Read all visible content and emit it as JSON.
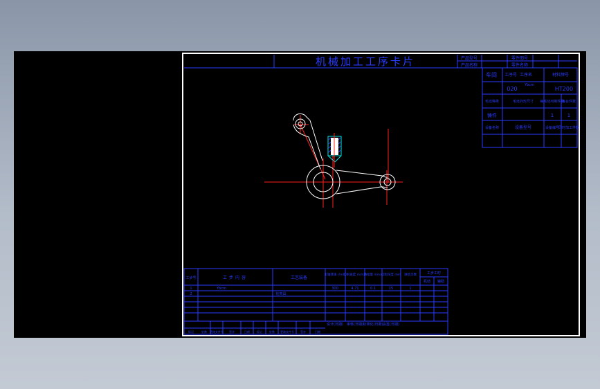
{
  "drawing": {
    "title": "机械加工工序卡片",
    "header_small": [
      "产品型号",
      "产品名称",
      "零件图号",
      "零件名称"
    ],
    "workshop_label": "车间",
    "col_headers": [
      "工序号",
      "工序名",
      "材料牌号"
    ],
    "process_no": "020",
    "process_name": "Ybcm",
    "material": "HT200",
    "blank_headers": [
      "毛坯种类",
      "毛坯外形尺寸",
      "每毛坯可制件数",
      "每台件数"
    ],
    "blank_type": "铸件",
    "blank_counts": [
      "1",
      "1"
    ],
    "equipment_headers": [
      "设备名称",
      "设备型号",
      "设备编号",
      "同时加工件数"
    ],
    "step_table": {
      "headers": [
        "工步号",
        "工步内容",
        "工艺装备",
        "主轴转速 r/min",
        "切削速度 m/min",
        "进给量 mm/r",
        "切削深度 mm",
        "进给次数",
        "工步工时"
      ],
      "sub_headers": [
        "机动",
        "辅助"
      ],
      "rows": [
        {
          "no": "1",
          "content": "Ybcm",
          "tool": "钻夹具",
          "values": [
            "300",
            "4.71",
            "0.1",
            "15",
            "1"
          ]
        },
        {
          "no": "2",
          "content": "",
          "tool": "",
          "values": []
        }
      ],
      "footer": [
        "设计(日期)",
        "审核(日期)",
        "标准化(日期)",
        "会签(日期)"
      ],
      "bottom_row": [
        "标记",
        "处数",
        "更改文件号",
        "签字",
        "日期",
        "标记",
        "处数",
        "更改文件号",
        "签字",
        "日期"
      ]
    }
  }
}
